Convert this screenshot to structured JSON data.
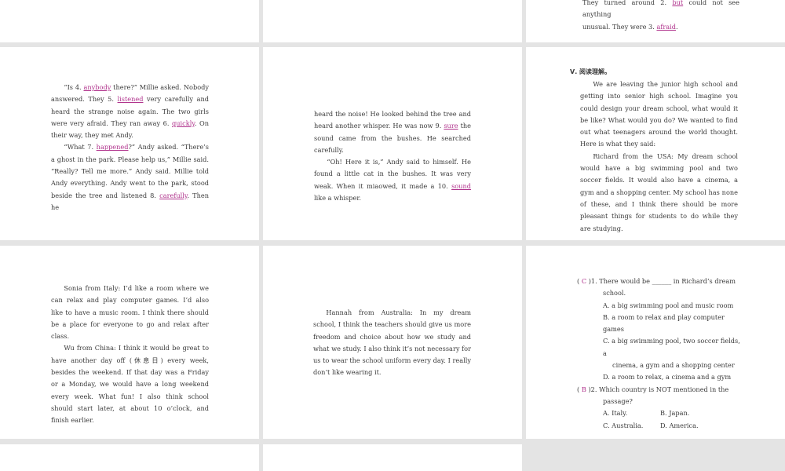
{
  "p1": {
    "top": {
      "a": "They turned around 2.",
      "b": "but",
      "c": "could not see anything",
      "d": "unusual. They were 3.",
      "e": "afraid",
      "f": "."
    }
  },
  "p2": {
    "paragraphs": [
      {
        "pre": "“Is 4.",
        "a1": "anybody",
        "m1": " there?” Millie asked. Nobody answered. They 5.",
        "a2": "listened",
        "m2": " very carefully and heard the strange noise again. The two girls were very afraid. They ran away 6.",
        "a3": "quickly",
        "m3": ". On their way, they met Andy."
      },
      {
        "pre": "“What 7.",
        "a1": "happened",
        "m1": "?” Andy asked. “There’s a ghost in the park. Please help us,” Millie said. “Really? Tell me more.” Andy said. Millie told Andy everything. Andy went to the park, stood beside the tree and listened 8.",
        "a2": "carefully",
        "m2": ". Then he"
      }
    ]
  },
  "p3": {
    "paragraphs": [
      {
        "pre": "heard the noise! He looked behind the tree and heard another whisper. He was now 9.",
        "a1": "sure",
        "m1": " the sound came from the bushes. He searched carefully."
      },
      {
        "pre": "“Oh! Here it is,” Andy said to himself. He found a little cat in the bushes. It was very weak. When it miaowed, it made a 10.",
        "a1": "sound",
        "m1": " like a whisper."
      }
    ]
  },
  "p4": {
    "heading": "Ⅴ. 阅读理解。",
    "para1": "We are leaving the junior high school and getting into senior high school. Imagine you could design your dream school, what would it be like? What would you do? We wanted to find out what teenagers around the world thought. Here is what they said:",
    "para2": "Richard from the USA: My dream school would have a big swimming pool and two soccer fields. It would also have a cinema, a gym and a shopping center. My school has none of these, and I think there should be more pleasant things for students to do while they are studying."
  },
  "p5": {
    "para1": "Sonia from Italy: I’d like a room where we can relax and play computer games. I’d also like to have a music room. I think there should be a place for everyone to go and relax after class.",
    "para2": "Wu from China: I think it would be great to have another day off (休息日) every week, besides the weekend. If that day was a Friday or a Monday, we would have a long weekend every week. What fun! I also think school should start later, at about 10 o’clock, and finish earlier."
  },
  "p6": {
    "para1": "Hannah from Australia: In my dream school, I think the teachers should give us more freedom and choice about how we study and what we study. I also think it’s not necessary for us to wear the school uniform every day. I really don’t like wearing it."
  },
  "p7": {
    "q1": {
      "open": "(",
      "answer": "C",
      "close": ")",
      "stem": "1. There would be ______ in Richard’s dream",
      "stem2": "school.",
      "A": "A. a big swimming pool and music room",
      "B": "B. a room to relax and play computer games",
      "C": "C. a big swimming pool, two soccer fields, a",
      "C2": "cinema, a gym and a shopping center",
      "D": "D. a room to relax, a cinema and a gym"
    },
    "q2": {
      "open": "(",
      "answer": "B",
      "close": ")",
      "stem": "2. Which country is NOT mentioned in the",
      "stem2": "passage?",
      "A": "A. Italy.",
      "B": "B. Japan.",
      "C": "C. Australia.",
      "D": "D. America."
    }
  }
}
